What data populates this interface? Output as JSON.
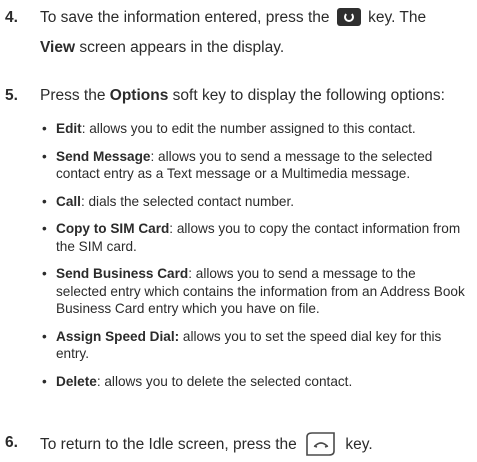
{
  "step4": {
    "number": "4.",
    "text_before": "To save the information entered, press the",
    "key_icon": "ok-key-icon",
    "text_after": "key. The",
    "line2_bold": "View",
    "line2_rest": " screen appears in the display."
  },
  "step5": {
    "number": "5.",
    "text_before": "Press the ",
    "bold": "Options",
    "text_after": " soft key to display the following options:",
    "bullets": [
      {
        "label": "Edit",
        "desc": ": allows you to edit the number assigned to this contact."
      },
      {
        "label": "Send Message",
        "desc": ": allows you to send a message to the selected contact entry as a Text message or a Multimedia message."
      },
      {
        "label": "Call",
        "desc": ": dials the selected contact number."
      },
      {
        "label": "Copy to SIM Card",
        "desc": ": allows you to copy the contact information from the SIM card."
      },
      {
        "label": "Send Business Card",
        "desc": ": allows you to send a message to the selected entry which contains the information from an Address Book Business Card entry which you have on file."
      },
      {
        "label": "Assign Speed Dial:",
        "desc": " allows you to set the speed dial key for this entry."
      },
      {
        "label": "Delete",
        "desc": ": allows you to delete the selected contact."
      }
    ]
  },
  "step6": {
    "number": "6.",
    "text_before": "To return to the Idle screen, press the",
    "key_icon": "end-key-icon",
    "text_after": "key."
  }
}
